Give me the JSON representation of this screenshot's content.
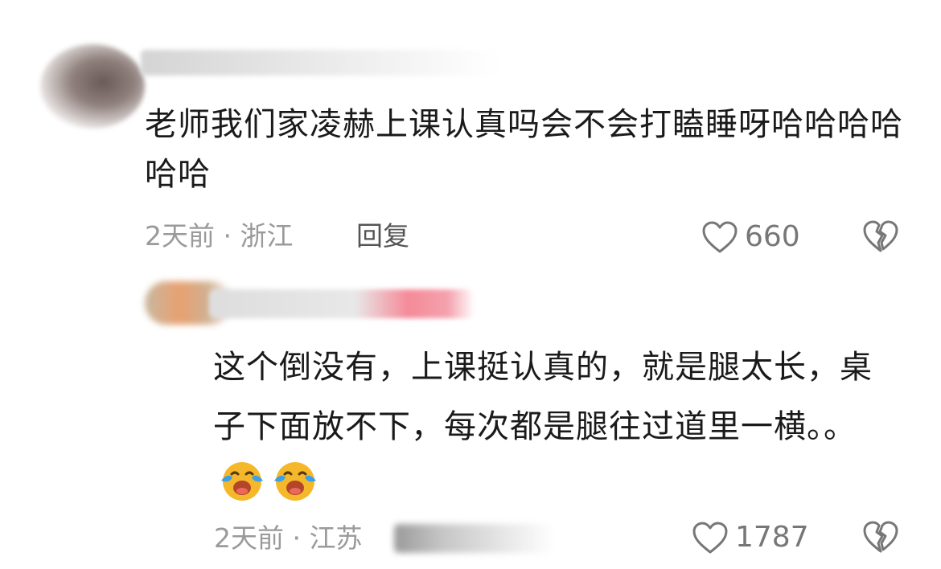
{
  "comments": [
    {
      "text": "老师我们家凌赫上课认真吗会不会打瞌睡呀哈哈哈哈哈哈",
      "time": "2天前",
      "separator": "·",
      "location": "浙江",
      "reply_label": "回复",
      "likes": "660"
    },
    {
      "text": "这个倒没有，上课挺认真的，就是腿太长，桌子下面放不下，每次都是腿往过道里一横。。",
      "time": "2天前",
      "separator": "·",
      "location": "江苏",
      "likes": "1787"
    }
  ],
  "icons": {
    "like": "heart-outline-icon",
    "dislike": "broken-heart-icon",
    "emoji": "crying-laughing-emoji-icon"
  },
  "colors": {
    "meta_text": "#9a9a9a",
    "icon_stroke": "#777777",
    "emoji_face": "#f5b82a",
    "emoji_tears": "#3aa0e8"
  }
}
